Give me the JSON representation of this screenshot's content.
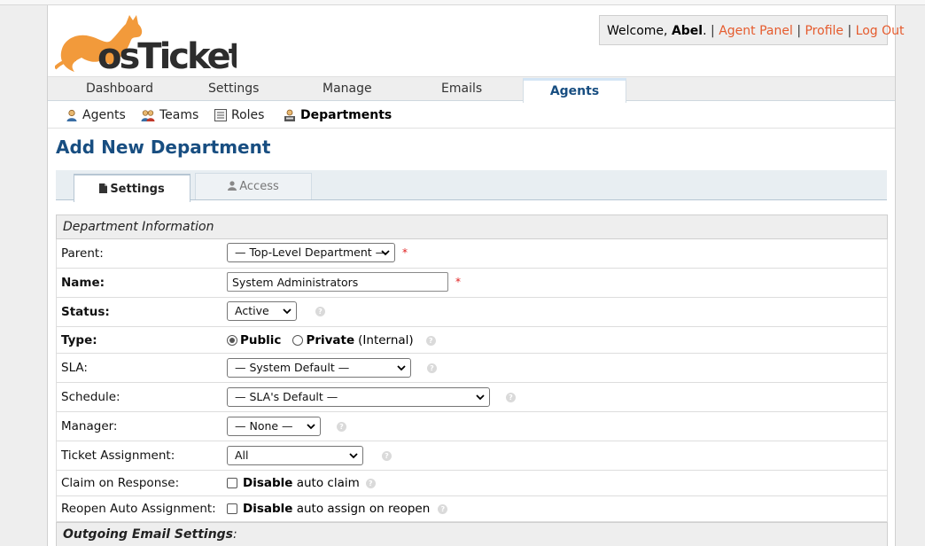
{
  "header": {
    "welcome_prefix": "Welcome, ",
    "user_name": "Abel",
    "welcome_suffix": ".",
    "links": [
      "Agent Panel",
      "Profile",
      "Log Out"
    ],
    "link_color": "#e55b2d"
  },
  "nav": {
    "tabs": [
      "Dashboard",
      "Settings",
      "Manage",
      "Emails",
      "Agents"
    ],
    "active": "Agents"
  },
  "subnav": {
    "items": [
      "Agents",
      "Teams",
      "Roles",
      "Departments"
    ],
    "active": "Departments"
  },
  "page": {
    "title": "Add New Department",
    "title_color": "#184e81"
  },
  "form_tabs": {
    "settings": "Settings",
    "access": "Access"
  },
  "form": {
    "section_title": "Department Information",
    "parent": {
      "label": "Parent:",
      "value": "— Top-Level Department —",
      "required": "*"
    },
    "name": {
      "label": "Name:",
      "value": "System Administrators",
      "required": "*"
    },
    "status": {
      "label": "Status:",
      "value": "Active"
    },
    "type": {
      "label": "Type:",
      "option_public": "Public",
      "option_private": "Private",
      "private_note": "(Internal)"
    },
    "sla": {
      "label": "SLA:",
      "value": "— System Default —"
    },
    "schedule": {
      "label": "Schedule:",
      "value": "— SLA's Default —"
    },
    "manager": {
      "label": "Manager:",
      "value": "— None —"
    },
    "ticket_assignment": {
      "label": "Ticket Assignment:",
      "value": "All"
    },
    "claim_on_response": {
      "label": "Claim on Response:",
      "check_bold": "Disable",
      "check_text": " auto claim"
    },
    "reopen_auto_assignment": {
      "label": "Reopen Auto Assignment:",
      "check_bold": "Disable",
      "check_text": " auto assign on reopen"
    },
    "outgoing_section": "Outgoing Email Settings",
    "outgoing_suffix": ":"
  },
  "help_glyph": "?"
}
